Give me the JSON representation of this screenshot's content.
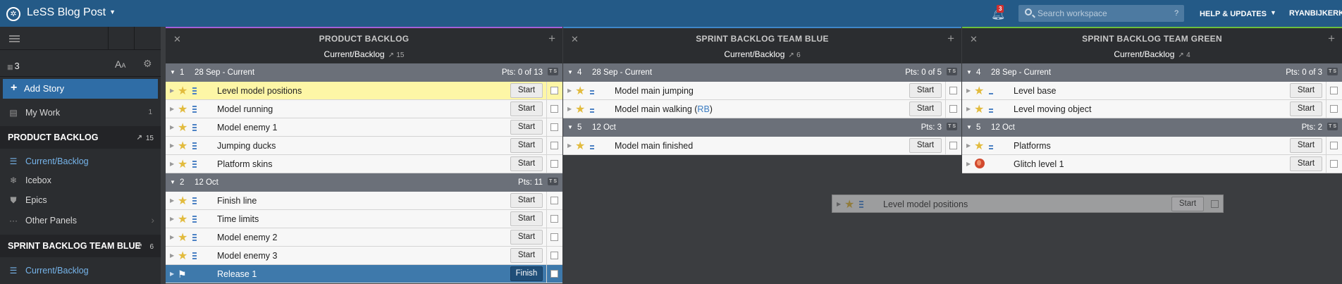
{
  "app": {
    "title": "LeSS Blog Post",
    "logo_glyph": "✲"
  },
  "topbar": {
    "notification_count": "3",
    "search_placeholder": "Search workspace",
    "search_help": "?",
    "help_label": "HELP & UPDATES",
    "user_label": "RYANBIJKERK"
  },
  "sidebar": {
    "count": "3",
    "text_size_label": "A",
    "text_size_small": "A",
    "add_story": "Add Story",
    "my_work": {
      "label": "My Work",
      "count": "1"
    },
    "section1": {
      "title": "PRODUCT BACKLOG",
      "count": "15"
    },
    "section1_items": [
      {
        "label": "Current/Backlog",
        "active": true,
        "icon": "list-icon"
      },
      {
        "label": "Icebox",
        "icon": "snowflake-icon"
      },
      {
        "label": "Epics",
        "icon": "shield-icon"
      },
      {
        "label": "Other Panels",
        "icon": "dots-icon"
      }
    ],
    "section2": {
      "title": "SPRINT BACKLOG TEAM BLUE",
      "count": "6"
    },
    "section2_items": [
      {
        "label": "Current/Backlog",
        "active": true,
        "icon": "list-icon"
      }
    ]
  },
  "panels": [
    {
      "title": "PRODUCT BACKLOG",
      "subtitle": "Current/Backlog",
      "count": "15",
      "accent": "#a55fd8",
      "groups": [
        {
          "num": "1",
          "date": "28 Sep - Current",
          "pts": "Pts: 0 of 13",
          "stories": [
            {
              "title": "Level model positions",
              "btn": "Start",
              "highlight": true,
              "pri": "p3",
              "icon": "star-icon"
            },
            {
              "title": "Model running",
              "btn": "Start",
              "pri": "p3",
              "icon": "star-icon"
            },
            {
              "title": "Model enemy 1",
              "btn": "Start",
              "pri": "p3",
              "icon": "star-icon"
            },
            {
              "title": "Jumping ducks",
              "btn": "Start",
              "pri": "p3",
              "icon": "star-icon"
            },
            {
              "title": "Platform skins",
              "btn": "Start",
              "pri": "p3",
              "icon": "star-icon"
            }
          ]
        },
        {
          "num": "2",
          "date": "12 Oct",
          "pts": "Pts: 11",
          "stories": [
            {
              "title": "Finish line",
              "btn": "Start",
              "pri": "p3",
              "icon": "star-icon"
            },
            {
              "title": "Time limits",
              "btn": "Start",
              "pri": "p3",
              "icon": "star-icon"
            },
            {
              "title": "Model enemy 2",
              "btn": "Start",
              "pri": "p3",
              "icon": "star-icon"
            },
            {
              "title": "Model enemy 3",
              "btn": "Start",
              "pri": "p3",
              "icon": "star-icon"
            },
            {
              "title": "Release 1",
              "btn": "Finish",
              "selected": true,
              "icon": "release-flag-icon"
            }
          ]
        }
      ]
    },
    {
      "title": "SPRINT BACKLOG TEAM BLUE",
      "subtitle": "Current/Backlog",
      "count": "6",
      "accent": "#3f87c8",
      "groups": [
        {
          "num": "4",
          "date": "28 Sep - Current",
          "pts": "Pts: 0 of 5",
          "stories": [
            {
              "title": "Model main jumping",
              "btn": "Start",
              "pri": "p2",
              "icon": "star-icon"
            },
            {
              "title": "Model main walking",
              "tag": "RB",
              "btn": "Start",
              "pri": "p2",
              "icon": "star-icon"
            }
          ]
        },
        {
          "num": "5",
          "date": "12 Oct",
          "pts": "Pts: 3",
          "stories": [
            {
              "title": "Model main finished",
              "btn": "Start",
              "pri": "p2",
              "icon": "star-icon"
            }
          ]
        }
      ]
    },
    {
      "title": "SPRINT BACKLOG TEAM GREEN",
      "subtitle": "Current/Backlog",
      "count": "4",
      "accent": "#6cbf3c",
      "groups": [
        {
          "num": "4",
          "date": "28 Sep - Current",
          "pts": "Pts: 0 of 3",
          "stories": [
            {
              "title": "Level base",
              "btn": "Start",
              "pri": "p1",
              "icon": "star-icon"
            },
            {
              "title": "Level moving object",
              "btn": "Start",
              "pri": "p2",
              "icon": "star-icon"
            }
          ]
        },
        {
          "num": "5",
          "date": "12 Oct",
          "pts": "Pts: 2",
          "stories": [
            {
              "title": "Platforms",
              "btn": "Start",
              "pri": "p2",
              "icon": "star-icon"
            },
            {
              "title": "Glitch level 1",
              "btn": "Start",
              "icon": "bug-icon"
            }
          ]
        }
      ]
    }
  ],
  "drag_ghost": {
    "title": "Level model positions",
    "btn": "Start"
  },
  "ts_label": "T S",
  "spark_glyph": "↗"
}
